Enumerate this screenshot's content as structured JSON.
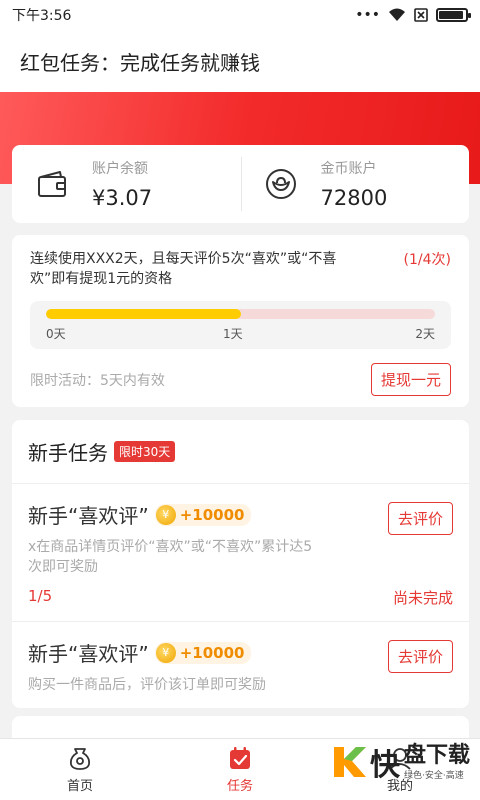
{
  "status_bar": {
    "time": "下午3:56",
    "dots": "•••"
  },
  "title": "红包任务：完成任务就赚钱",
  "balance": {
    "account_label": "账户余额",
    "account_value": "¥3.07",
    "coin_label": "金币账户",
    "coin_value": "72800"
  },
  "progress": {
    "description": "连续使用XXX2天，且每天评价5次“喜欢”或“不喜欢”即有提现1元的资格",
    "count": "(1/4次)",
    "fill_fraction": 0.5,
    "ticks": [
      "0天",
      "1天",
      "2天"
    ],
    "limit_text": "限时活动：5天内有效",
    "withdraw_button": "提现一元"
  },
  "newbie": {
    "title": "新手任务",
    "badge": "限时30天",
    "tasks": [
      {
        "title": "新手“喜欢评”",
        "reward": "+10000",
        "description": "x在商品详情页评价“喜欢”或“不喜欢”累计达5次即可奖励",
        "button": "去评价",
        "progress": "1/5",
        "status": "尚未完成"
      },
      {
        "title": "新手“喜欢评”",
        "reward": "+10000",
        "description": "购买一件商品后，评价该订单即可奖励",
        "button": "去评价"
      }
    ]
  },
  "tabbar": {
    "items": [
      {
        "label": "首页",
        "icon": "home-bag-icon"
      },
      {
        "label": "任务",
        "icon": "task-calendar-icon"
      },
      {
        "label": "我的",
        "icon": "profile-icon"
      }
    ],
    "active_color": "#e53935"
  },
  "watermark": {
    "char": "快",
    "name": "盘下载",
    "slogan": "绿色·安全·高速"
  },
  "colors": {
    "accent": "#e53935",
    "banner": "#f32b2b",
    "progress": "#ffcc00"
  }
}
